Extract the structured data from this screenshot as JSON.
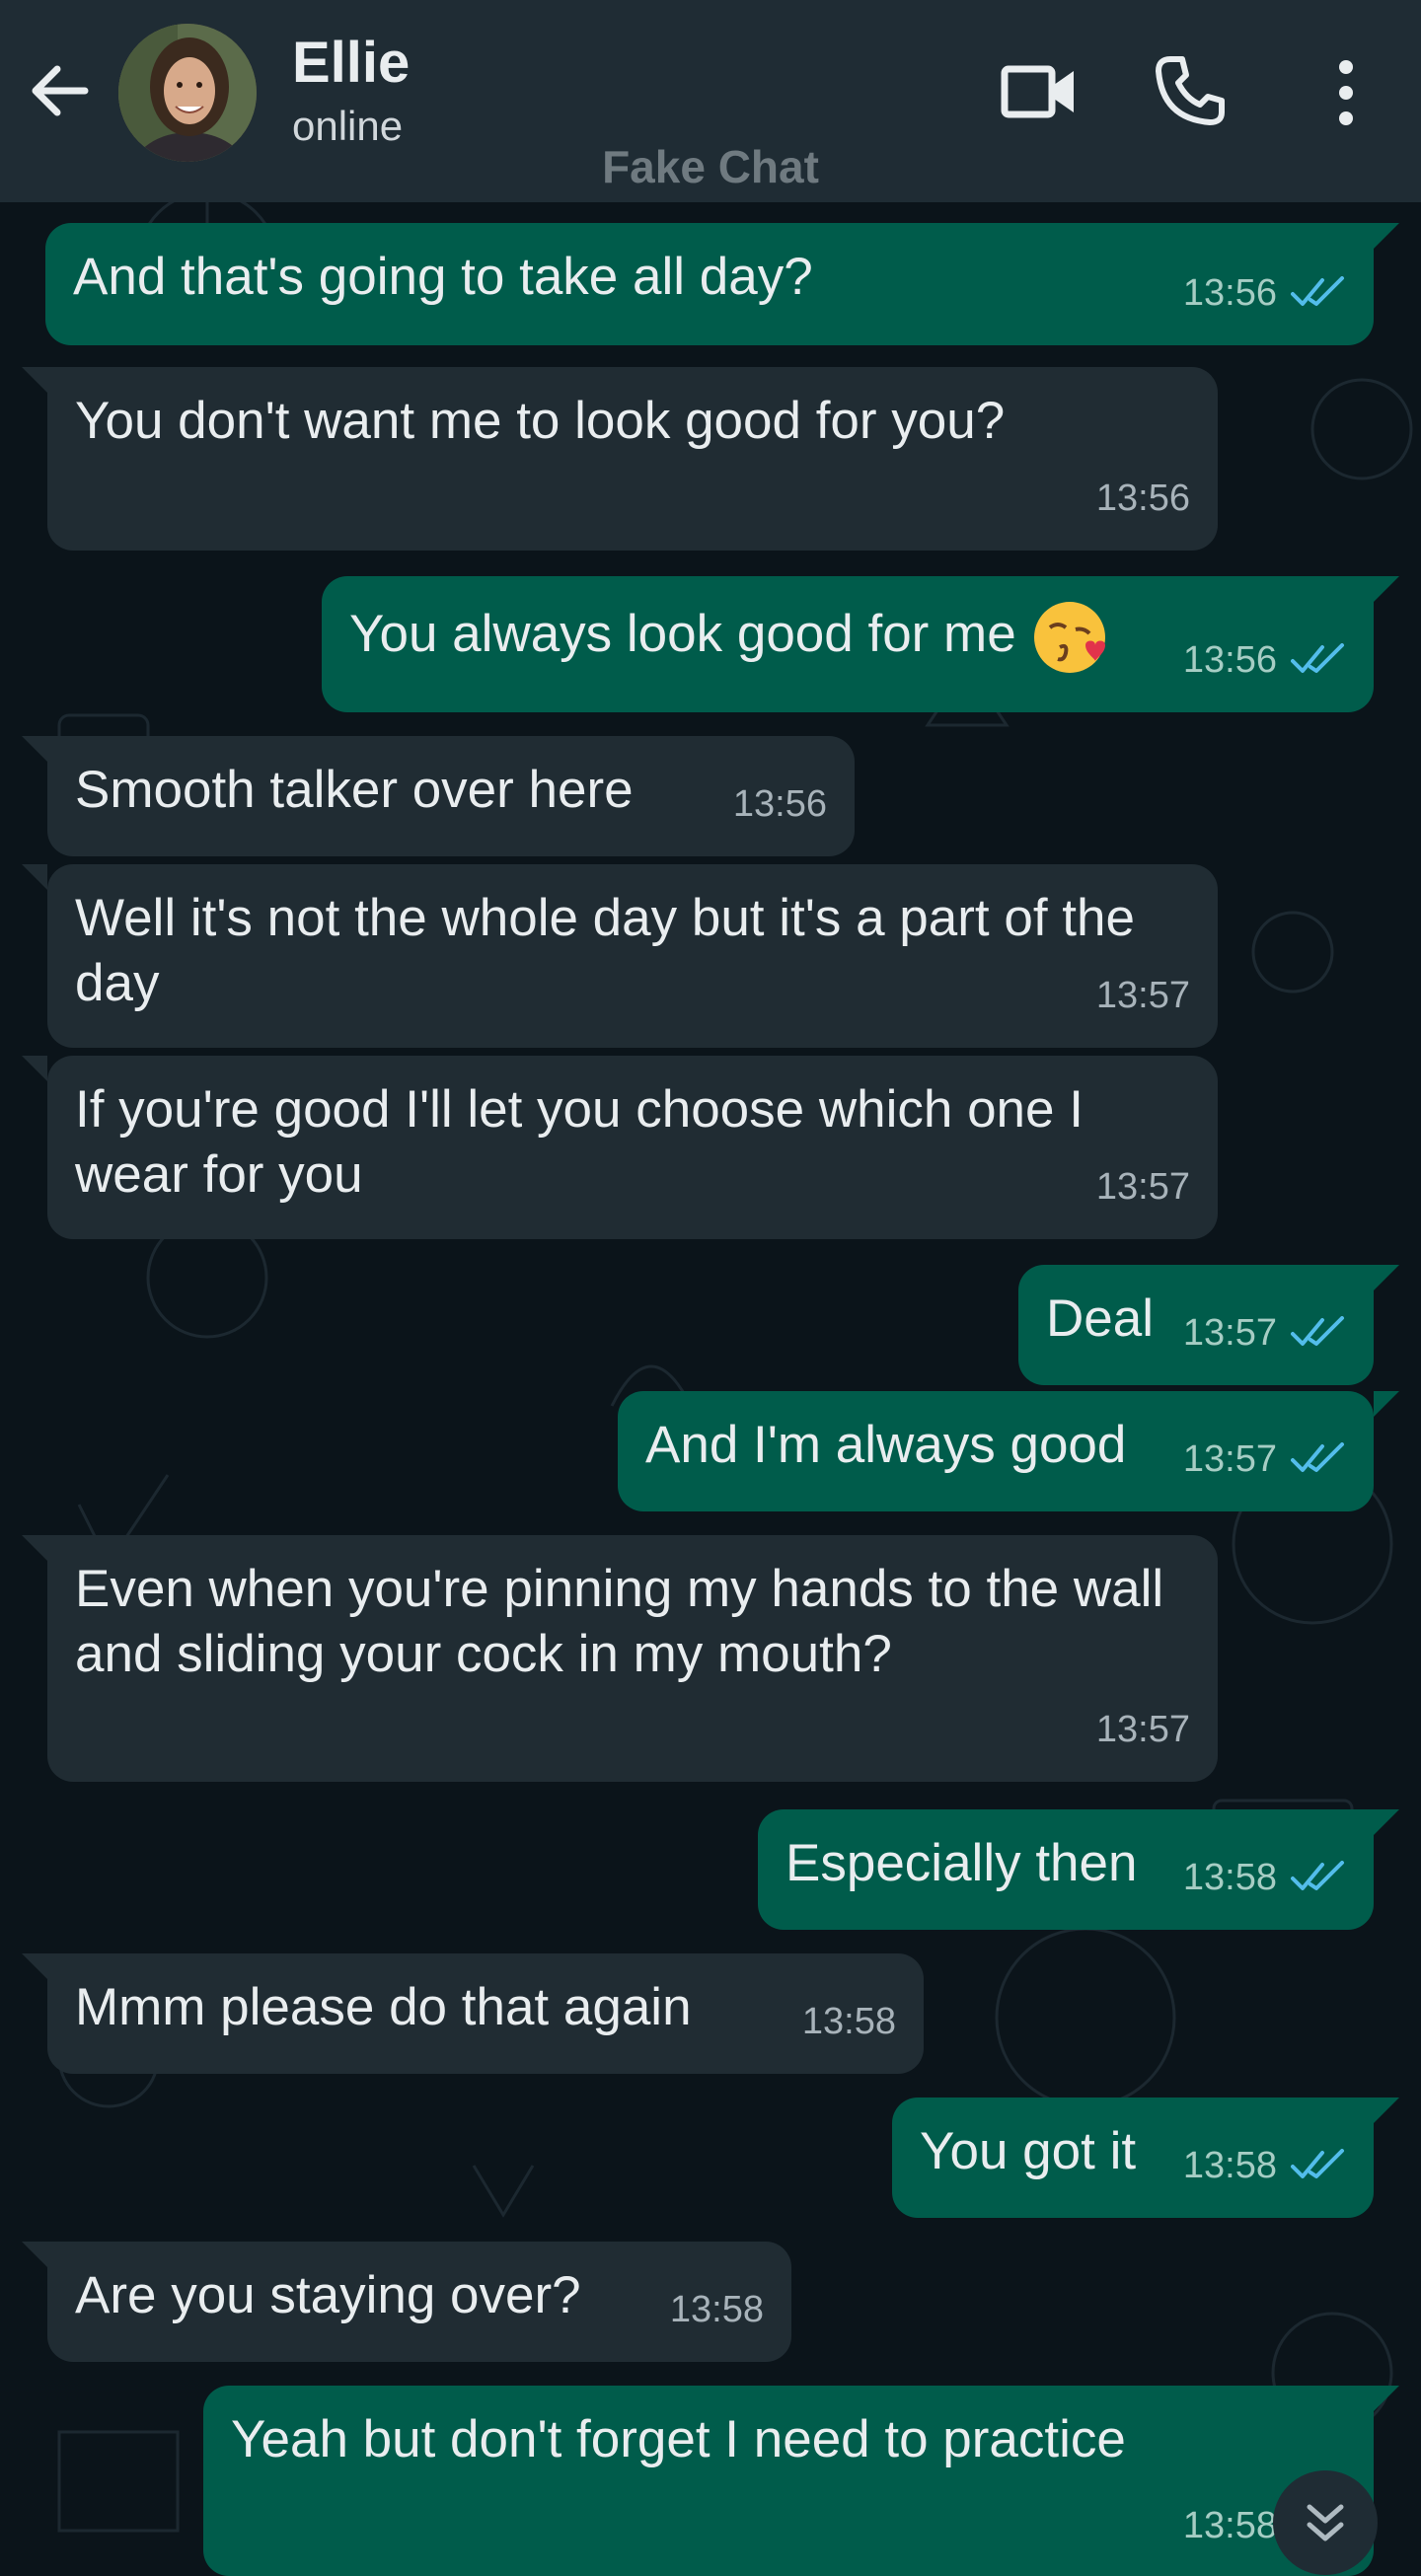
{
  "header": {
    "contact_name": "Ellie",
    "status": "online",
    "watermark": "Fake Chat",
    "icons": [
      "back-arrow-icon",
      "avatar",
      "video-call-icon",
      "phone-icon",
      "more-options-icon"
    ]
  },
  "colors": {
    "background": "#0b141a",
    "header": "#1f2c34",
    "incoming_bubble": "#202c33",
    "outgoing_bubble": "#005c4b",
    "read_ticks": "#53bdeb"
  },
  "messages": [
    {
      "dir": "out",
      "text": "And that's going to take all day?",
      "time": "13:56",
      "read": true
    },
    {
      "dir": "in",
      "text": "You don't want me to look good for you?",
      "time": "13:56"
    },
    {
      "dir": "out",
      "text": "You always look good for me",
      "emoji": "kissing-face-with-heart-emoji",
      "time": "13:56",
      "read": true
    },
    {
      "dir": "in",
      "text": "Smooth talker over here",
      "time": "13:56"
    },
    {
      "dir": "in",
      "text": "Well it's not the whole day but it's a part of the day",
      "time": "13:57"
    },
    {
      "dir": "in",
      "text": "If you're good I'll let you choose which one I wear for you",
      "time": "13:57"
    },
    {
      "dir": "out",
      "text": "Deal",
      "time": "13:57",
      "read": true
    },
    {
      "dir": "out",
      "text": "And I'm always good",
      "time": "13:57",
      "read": true
    },
    {
      "dir": "in",
      "text": "Even when you're pinning my hands to the wall and sliding your cock in my mouth?",
      "time": "13:57"
    },
    {
      "dir": "out",
      "text": "Especially then",
      "time": "13:58",
      "read": true
    },
    {
      "dir": "in",
      "text": "Mmm please do that again",
      "time": "13:58"
    },
    {
      "dir": "out",
      "text": "You got it",
      "time": "13:58",
      "read": true
    },
    {
      "dir": "in",
      "text": "Are you staying over?",
      "time": "13:58"
    },
    {
      "dir": "out",
      "text": "Yeah but don't forget I need to practice",
      "time": "13:58",
      "read": true
    }
  ],
  "scroll_down_icon": "double-chevron-down-icon"
}
